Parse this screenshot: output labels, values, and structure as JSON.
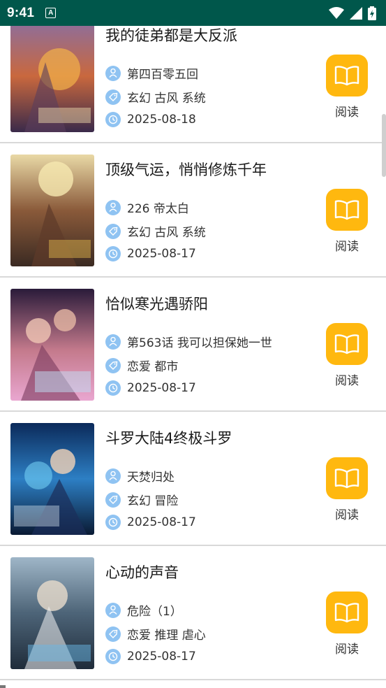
{
  "status_bar": {
    "time": "9:41",
    "a_badge": "A"
  },
  "colors": {
    "status_bar": "#00574B",
    "read_button": "#FFB80F",
    "meta_icon": "#8fc3f2"
  },
  "icons": {
    "author": "person-icon",
    "tags": "tag-icon",
    "date": "clock-icon",
    "read": "book-icon"
  },
  "items": [
    {
      "title": "我的徒弟都是大反派",
      "chapter": "第四百零五回",
      "tags": "玄幻 古风 系统",
      "date": "2025-08-18",
      "read_label": "阅读"
    },
    {
      "title": "顶级气运，悄悄修炼千年",
      "chapter": "226 帝太白",
      "tags": "玄幻 古风 系统",
      "date": "2025-08-17",
      "read_label": "阅读"
    },
    {
      "title": "恰似寒光遇骄阳",
      "chapter": "第563话 我可以担保她一世",
      "tags": "恋爱 都市",
      "date": "2025-08-17",
      "read_label": "阅读"
    },
    {
      "title": "斗罗大陆4终极斗罗",
      "chapter": "天焚归处",
      "tags": "玄幻 冒险",
      "date": "2025-08-17",
      "read_label": "阅读"
    },
    {
      "title": "心动的声音",
      "chapter": "危险（1）",
      "tags": "恋爱 推理 虐心",
      "date": "2025-08-17",
      "read_label": "阅读"
    }
  ]
}
